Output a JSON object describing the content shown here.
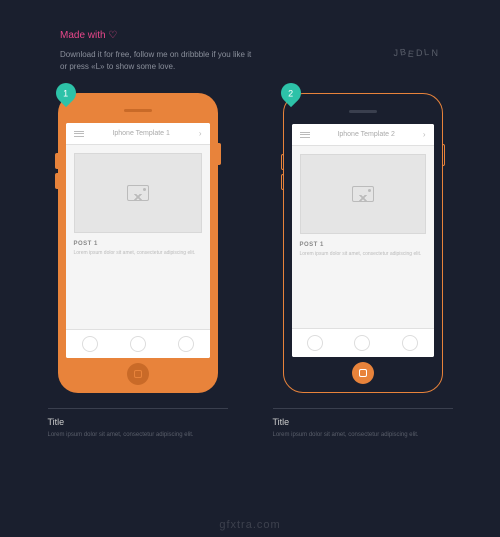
{
  "header": {
    "made_with": "Made with",
    "subtitle": "Download it for free, follow me on dribbble if you like it or press «L» to show some love.",
    "brand": "JBEDLN"
  },
  "phones": [
    {
      "badge": "1",
      "nav_title": "Iphone Template 1",
      "post_title": "POST 1",
      "post_body": "Lorem ipsum dolor sit amet, consectetur adipiscing elit."
    },
    {
      "badge": "2",
      "nav_title": "Iphone Template 2",
      "post_title": "POST 1",
      "post_body": "Lorem ipsum dolor sit amet, consectetur adipiscing elit."
    }
  ],
  "captions": [
    {
      "title": "Title",
      "body": "Lorem ipsum dolor sit amet, consectetur adipiscing elit."
    },
    {
      "title": "Title",
      "body": "Lorem ipsum dolor sit amet, consectetur adipiscing elit."
    }
  ],
  "watermark": "gfxtra.com"
}
